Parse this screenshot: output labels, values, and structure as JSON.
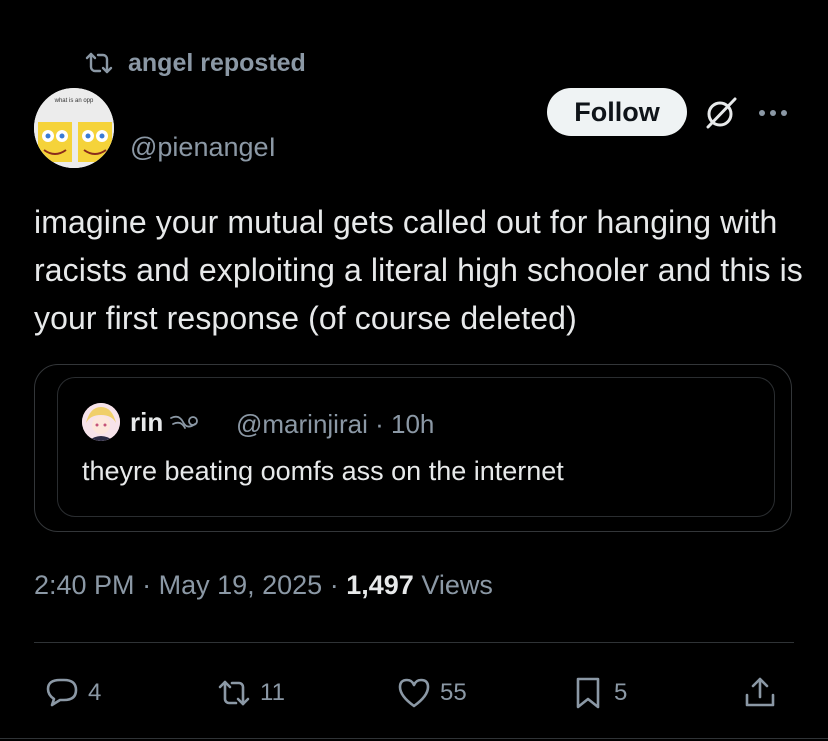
{
  "repost": {
    "text": "angel reposted",
    "icon": "repost-icon"
  },
  "author": {
    "handle": "@pienangeI",
    "avatar_caption": "what is an opp",
    "avatar_icon": "avatar"
  },
  "follow_label": "Follow",
  "tweet": {
    "text": "imagine your mutual gets called out for hanging with racists and exploiting a literal high schooler and this is your first response (of course deleted)"
  },
  "quote": {
    "name": "rin",
    "handle": "@marinjirai",
    "separator": "·",
    "time": "10h",
    "text": "theyre beating oomfs ass on the internet"
  },
  "meta": {
    "time": "2:40 PM",
    "sep1": "·",
    "date": "May 19, 2025",
    "sep2": "·",
    "views_count": "1,497",
    "views_label": "Views"
  },
  "actions": {
    "replies": "4",
    "reposts": "11",
    "likes": "55",
    "bookmarks": "5"
  },
  "colors": {
    "background": "#000000",
    "text_primary": "#e7e9ea",
    "text_secondary": "#8b98a5",
    "border": "#2f3336",
    "follow_bg": "#eff3f4"
  }
}
